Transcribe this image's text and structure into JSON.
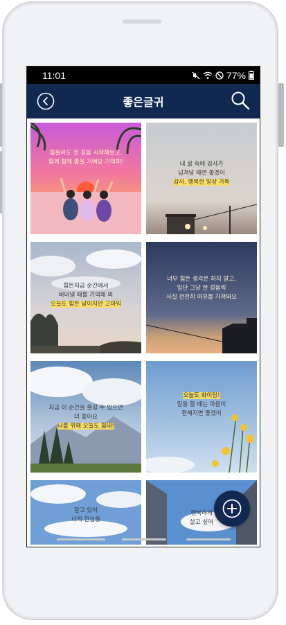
{
  "status": {
    "time": "11:01",
    "battery": "77%"
  },
  "appbar": {
    "title": "좋은글귀"
  },
  "cards": [
    {
      "lines": [
        "힘들어도 첫 걸음 시작해보고,",
        "함께 함께 좋을 거예요 기억해!"
      ],
      "highlight": ""
    },
    {
      "lines": [
        "내 삶 속에 감사가",
        "넘쳐날 때면 좋겠어"
      ],
      "highlight": "감사, 행복한 일상 가득"
    },
    {
      "lines": [
        "힘든지금 순간에서",
        "버텨낼 때를 기억해 봐"
      ],
      "highlight": "오늘도 힘든 날이지만 고마워"
    },
    {
      "lines": [
        "너무 힘든 생각은 하지 말고,",
        "일단 그냥 한 걸음씩",
        "사실 천천히 여유를 가져봐요"
      ],
      "highlight": ""
    },
    {
      "lines": [
        "지금 이 순간을 즐길 수 있으면",
        "더 좋아요"
      ],
      "highlight": "나를 위해 오늘도 힘내!"
    },
    {
      "lines": [
        "일을 할 때는 마음이",
        "편해지면 좋겠어"
      ],
      "highlight": "오늘도 화이팅!"
    },
    {
      "lines": [
        "알고 있어",
        "너의 진심을"
      ],
      "highlight": ""
    },
    {
      "lines": [
        "행복하게",
        "살고 싶어"
      ],
      "highlight": ""
    }
  ]
}
